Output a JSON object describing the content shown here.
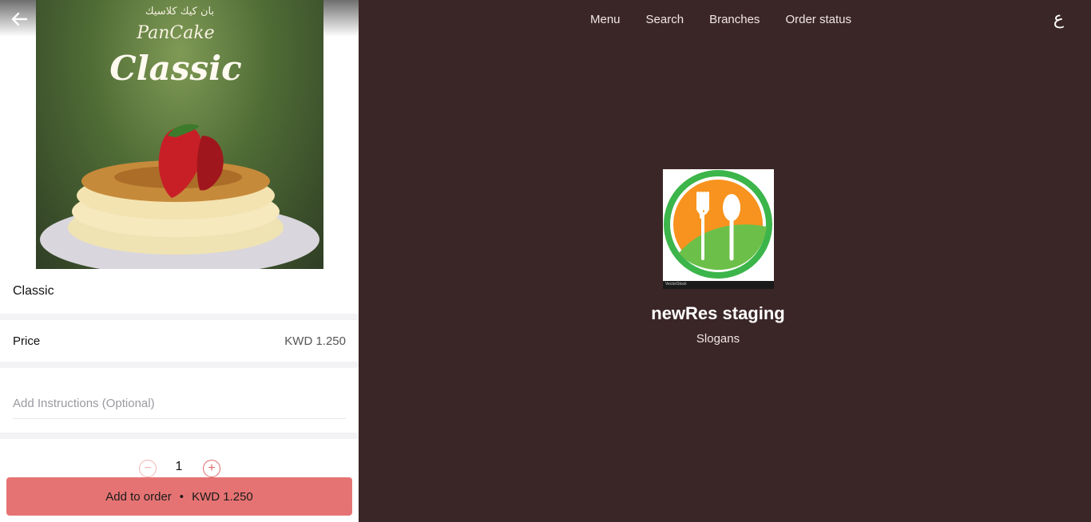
{
  "product": {
    "image_banner_text_ar": "بان كيك كلاسيك",
    "image_banner_script": "PanCake",
    "image_banner_title": "Classic",
    "name": "Classic",
    "price_label": "Price",
    "price_value": "KWD 1.250",
    "instructions_placeholder": "Add Instructions (Optional)",
    "quantity": "1",
    "add_button_label": "Add to order",
    "add_button_separator": "•",
    "add_button_total": "KWD 1.250"
  },
  "nav": {
    "items": [
      "Menu",
      "Search",
      "Branches",
      "Order status"
    ],
    "language_toggle": "ع"
  },
  "restaurant": {
    "name": "newRes staging",
    "slogan": "Slogans",
    "logo_footer_text": "VectorStock"
  },
  "colors": {
    "panel_background": "#3b2627",
    "accent": "#e67373",
    "logo_orange": "#f7931e",
    "logo_green": "#3cb54a"
  },
  "icons": {
    "back": "arrow-left-icon",
    "minus": "minus-circle-icon",
    "plus": "plus-circle-icon"
  }
}
